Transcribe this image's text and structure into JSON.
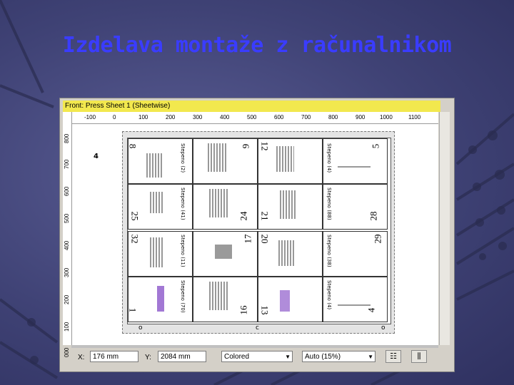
{
  "slide": {
    "title": "Izdelava montaže z računalnikom"
  },
  "window": {
    "title": "Front: Press Sheet 1 (Sheetwise)"
  },
  "hruler": {
    "ticks": [
      "-100",
      "0",
      "100",
      "200",
      "300",
      "400",
      "500",
      "600",
      "700",
      "800",
      "900",
      "1000",
      "1100"
    ]
  },
  "vruler": {
    "ticks": [
      "800",
      "700",
      "600",
      "500",
      "400",
      "300",
      "200",
      "100",
      "000"
    ]
  },
  "sheet": {
    "marker": "4",
    "cells": [
      {
        "num": "8",
        "num2": "9",
        "slug": "Stepeno (2)"
      },
      {
        "num": "12",
        "num2": "5",
        "slug": "Stepeno (4)"
      },
      {
        "num": "25",
        "num2": "24",
        "slug": "Stepeno (41)"
      },
      {
        "num": "21",
        "num2": "28",
        "slug": "Stepeno (88)"
      },
      {
        "num": "32",
        "num2": "17",
        "slug": "Stepeno (11)"
      },
      {
        "num": "20",
        "num2": "29",
        "slug": "Stepeno (38)"
      },
      {
        "num": "1",
        "num2": "16",
        "slug": "Stepeno (70)"
      },
      {
        "num": "13",
        "num2": "4",
        "slug": "Stepeno (4)"
      }
    ],
    "bottom_marks": [
      "o",
      "c",
      "o"
    ]
  },
  "status": {
    "x_label": "X:",
    "x_value": "176 mm",
    "y_label": "Y:",
    "y_value": "2084 mm",
    "color_mode": "Colored",
    "zoom": "Auto (15%)"
  },
  "colors": {
    "title": "#3a3cff",
    "titlebar": "#f2e84e",
    "background": "#3f4275"
  }
}
